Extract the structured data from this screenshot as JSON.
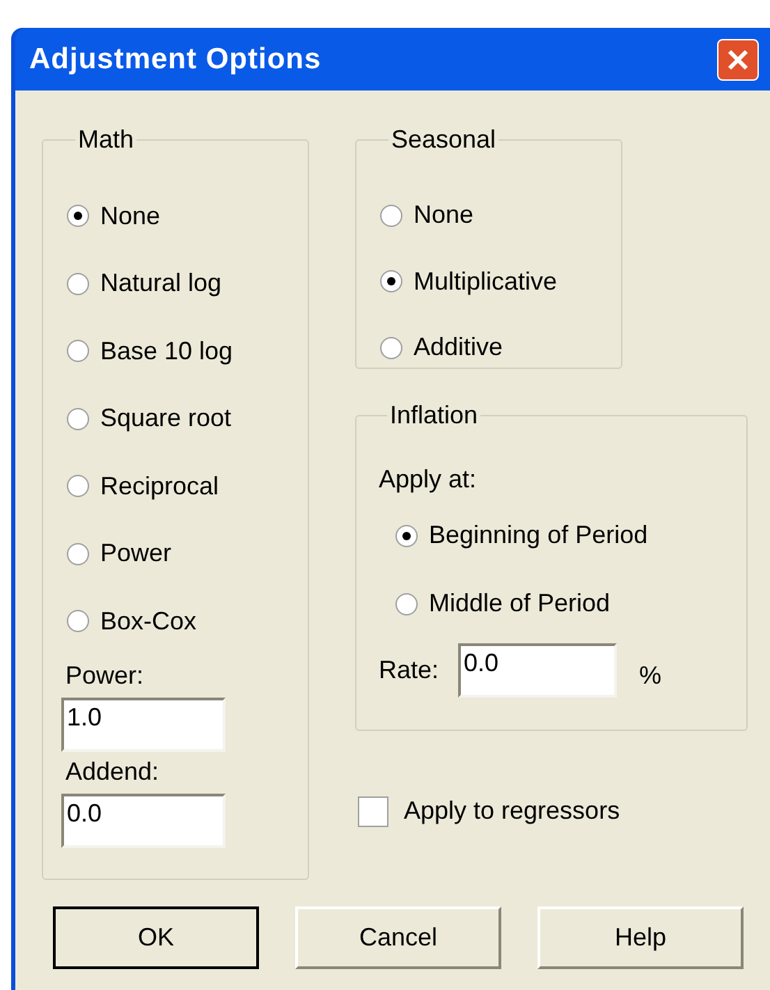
{
  "window": {
    "title": "Adjustment Options"
  },
  "math": {
    "label": "Math",
    "options": [
      {
        "label": "None",
        "selected": true
      },
      {
        "label": "Natural log",
        "selected": false
      },
      {
        "label": "Base 10 log",
        "selected": false
      },
      {
        "label": "Square root",
        "selected": false
      },
      {
        "label": "Reciprocal",
        "selected": false
      },
      {
        "label": "Power",
        "selected": false
      },
      {
        "label": "Box-Cox",
        "selected": false
      }
    ],
    "power": {
      "label": "Power:",
      "value": "1.0"
    },
    "addend": {
      "label": "Addend:",
      "value": "0.0"
    }
  },
  "seasonal": {
    "label": "Seasonal",
    "options": [
      {
        "label": "None",
        "selected": false
      },
      {
        "label": "Multiplicative",
        "selected": true
      },
      {
        "label": "Additive",
        "selected": false
      }
    ]
  },
  "inflation": {
    "label": "Inflation",
    "apply_at_label": "Apply at:",
    "options": [
      {
        "label": "Beginning of Period",
        "selected": true
      },
      {
        "label": "Middle of Period",
        "selected": false
      }
    ],
    "rate": {
      "label": "Rate:",
      "value": "0.0",
      "unit": "%"
    }
  },
  "apply_to_regressors": {
    "label": "Apply to regressors",
    "checked": false
  },
  "buttons": [
    {
      "label": "OK",
      "default": true
    },
    {
      "label": "Cancel",
      "default": false
    },
    {
      "label": "Help",
      "default": false
    }
  ]
}
